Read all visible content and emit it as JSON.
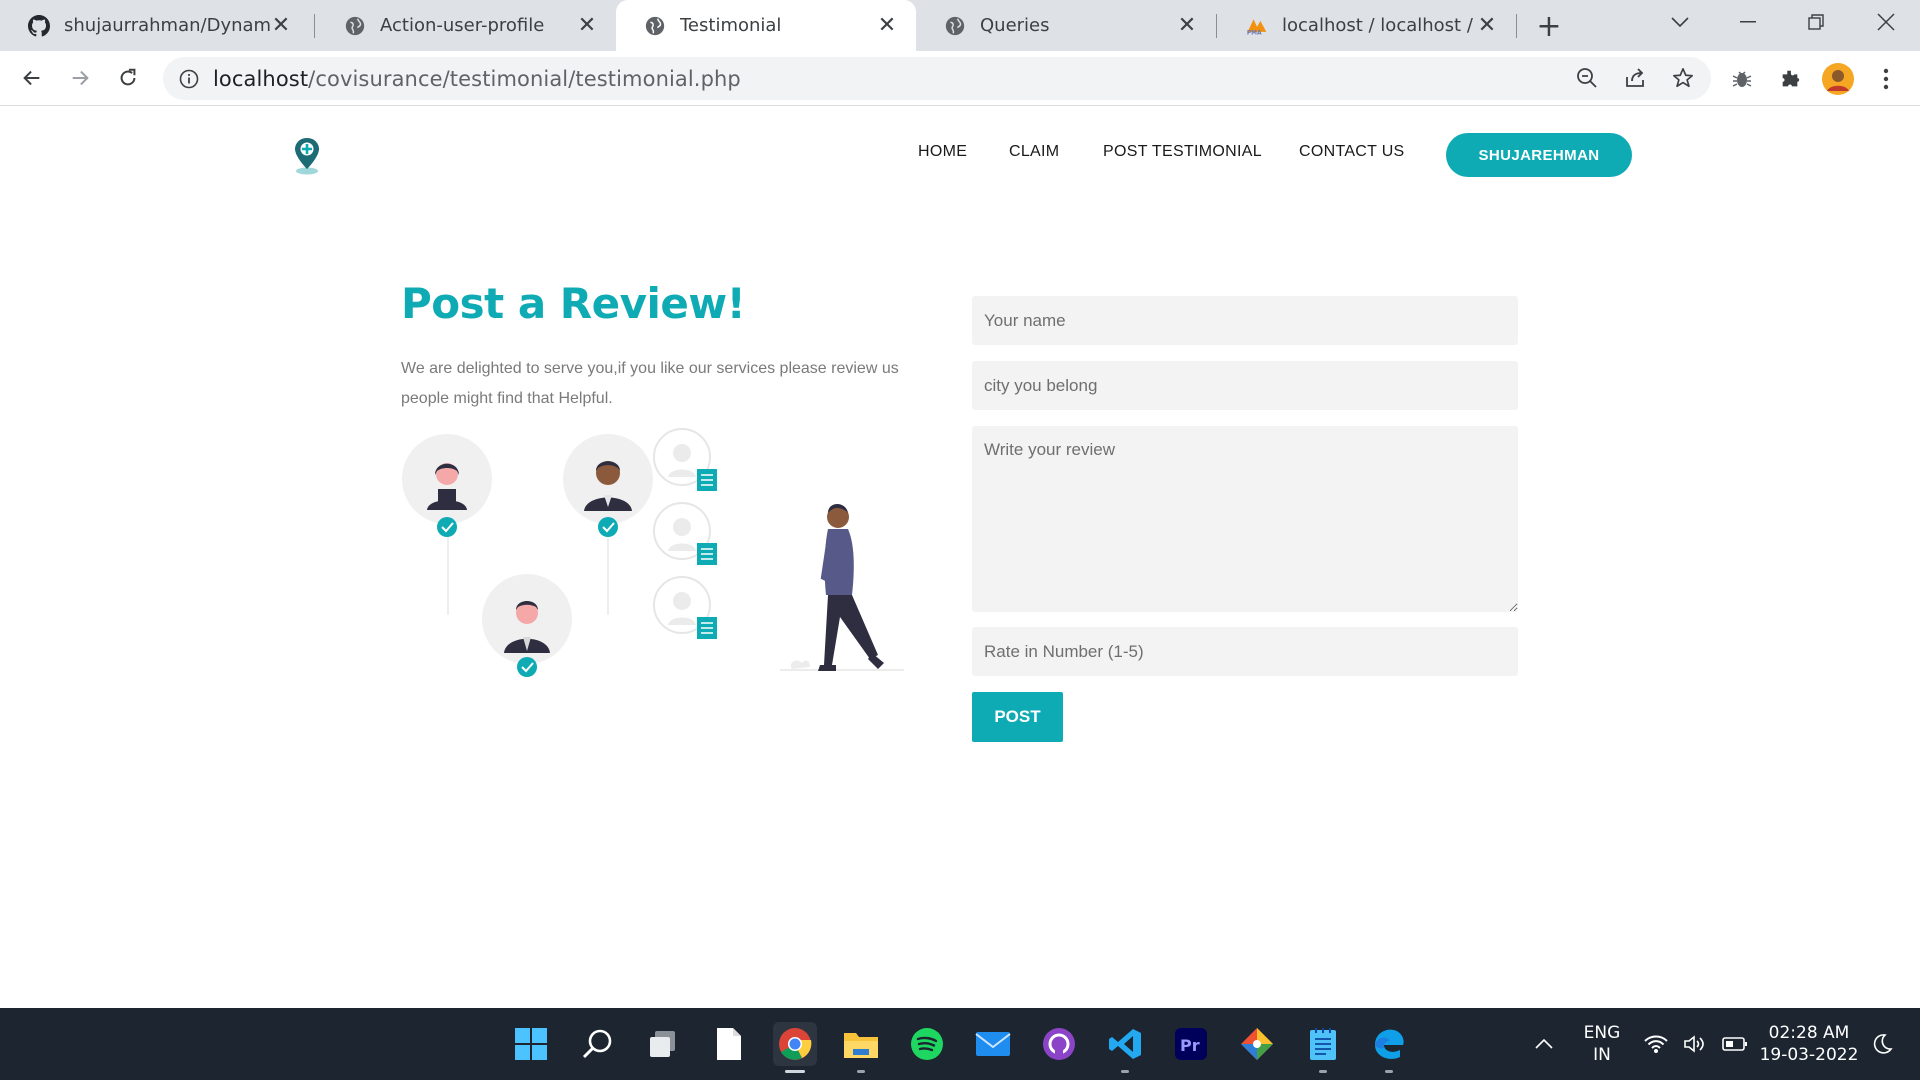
{
  "browser": {
    "tabs": [
      {
        "title": "shujaurrahman/Dynamic-I",
        "icon": "github-icon"
      },
      {
        "title": "Action-user-profile",
        "icon": "globe-icon"
      },
      {
        "title": "Testimonial",
        "icon": "globe-icon",
        "active": true
      },
      {
        "title": "Queries",
        "icon": "globe-icon"
      },
      {
        "title": "localhost / localhost / cov",
        "icon": "phpmyadmin-icon"
      }
    ],
    "url_host": "localhost",
    "url_path": "/covisurance/testimonial/testimonial.php"
  },
  "header": {
    "nav": [
      "HOME",
      "CLAIM",
      "POST TESTIMONIAL",
      "CONTACT US"
    ],
    "user": "SHUJAREHMAN"
  },
  "main": {
    "title": "Post a Review!",
    "description": "We are delighted to serve you,if you like our services please review us people might find that Helpful."
  },
  "form": {
    "name_placeholder": "Your name",
    "city_placeholder": "city you belong",
    "review_placeholder": "Write your review",
    "rating_placeholder": "Rate in Number (1-5)",
    "submit_label": "POST"
  },
  "taskbar": {
    "apps": [
      "start-icon",
      "search-icon",
      "task-view-icon",
      "notepad-file-icon",
      "chrome-icon",
      "file-explorer-icon",
      "spotify-icon",
      "mail-icon",
      "github-desktop-icon",
      "vscode-icon",
      "premiere-pro-icon",
      "git-icon",
      "notepad-icon",
      "edge-icon"
    ],
    "language": "ENG",
    "region": "IN",
    "time": "02:28 AM",
    "date": "19-03-2022"
  },
  "colors": {
    "accent": "#0fabb5",
    "field_bg": "#f3f3f3",
    "taskbar_bg": "#1c2530"
  }
}
